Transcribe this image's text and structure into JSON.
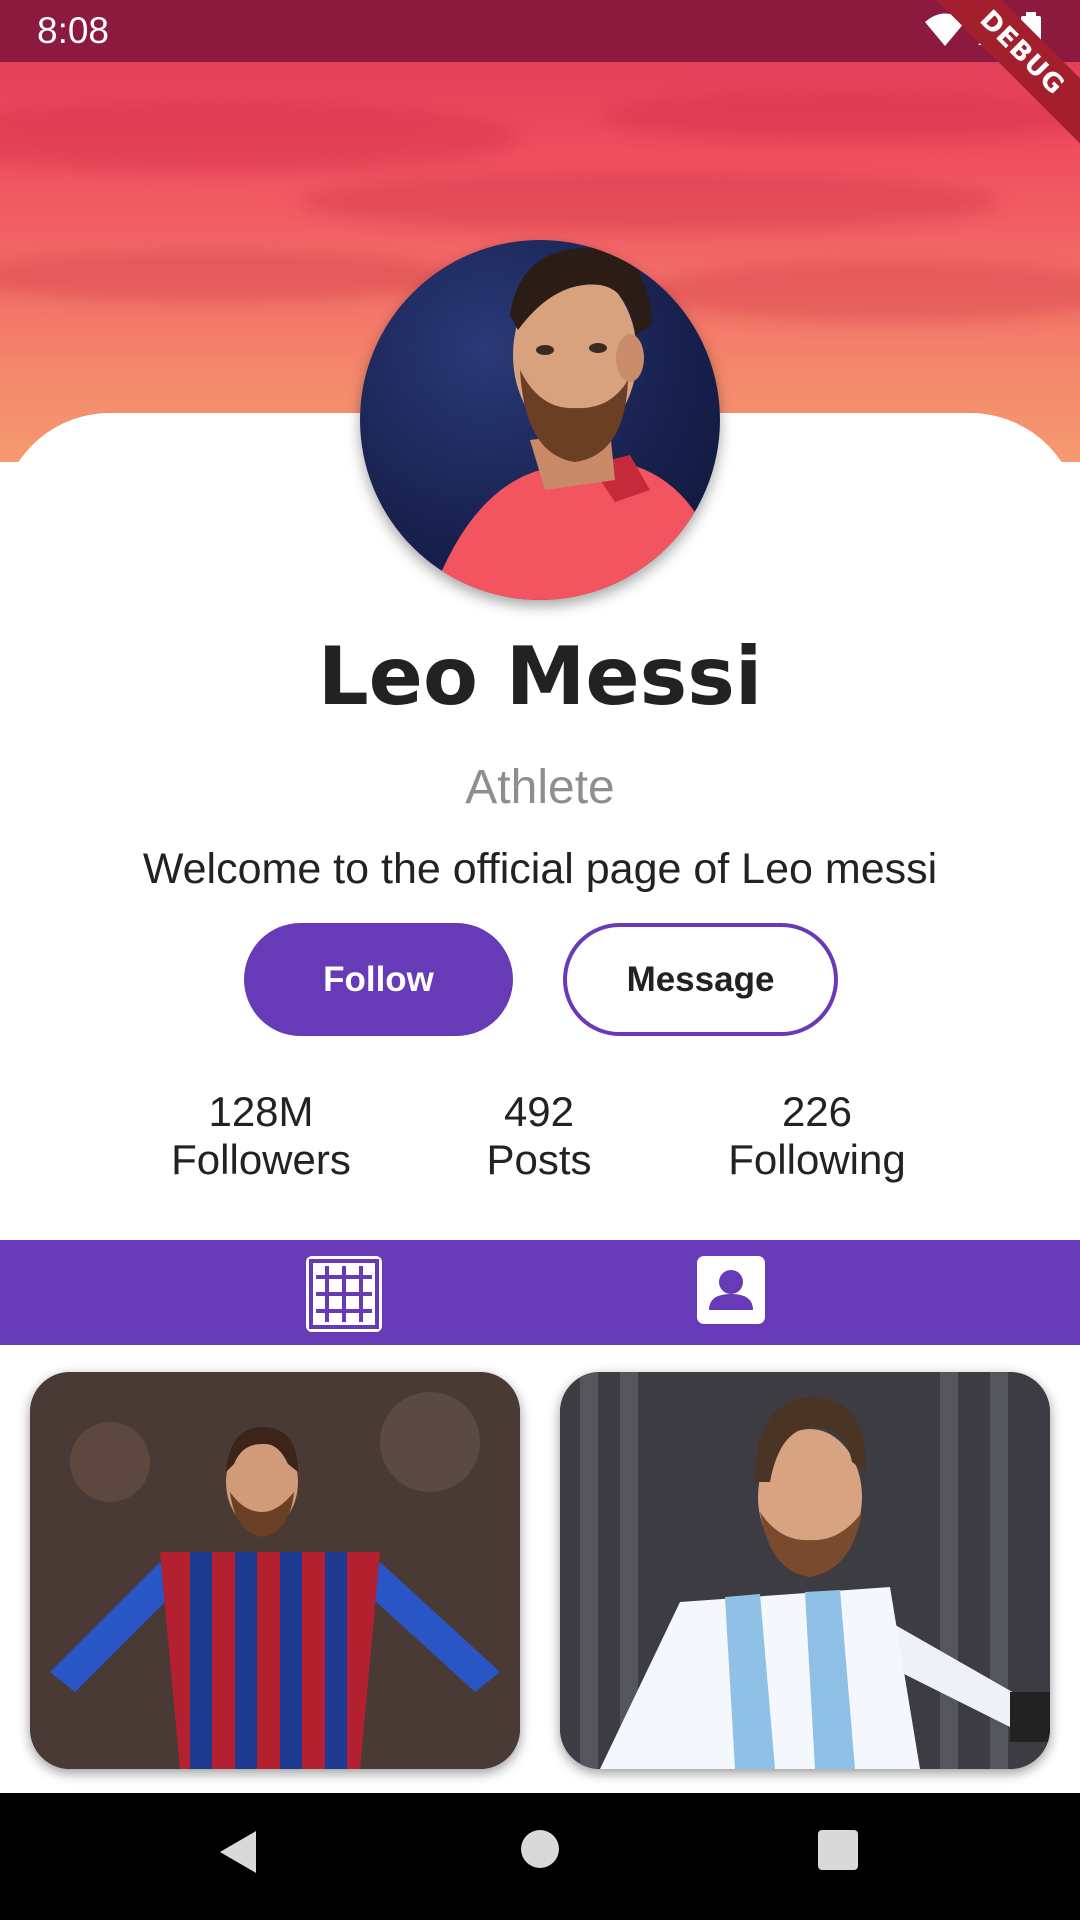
{
  "status_bar": {
    "time": "8:08",
    "debug_label": "DEBUG",
    "icons": [
      "wifi-icon",
      "signal-icon",
      "battery-icon"
    ]
  },
  "profile": {
    "name": "Leo Messi",
    "role": "Athlete",
    "bio": "Welcome to the official page of Leo messi"
  },
  "actions": {
    "follow_label": "Follow",
    "message_label": "Message"
  },
  "stats": [
    {
      "value": "128M",
      "label": "Followers"
    },
    {
      "value": "492",
      "label": "Posts"
    },
    {
      "value": "226",
      "label": "Following"
    }
  ],
  "tabs": [
    {
      "icon": "grid-icon"
    },
    {
      "icon": "contact-icon"
    }
  ],
  "photos": [
    {
      "description_icon": "photo-player-barcelona"
    },
    {
      "description_icon": "photo-player-argentina"
    }
  ],
  "nav": [
    "back-icon",
    "home-icon",
    "recents-icon"
  ],
  "colors": {
    "accent": "#673ab7",
    "status_bar": "#8c1a3e",
    "cover_top": "#e2405a",
    "cover_bottom": "#f59a70"
  }
}
